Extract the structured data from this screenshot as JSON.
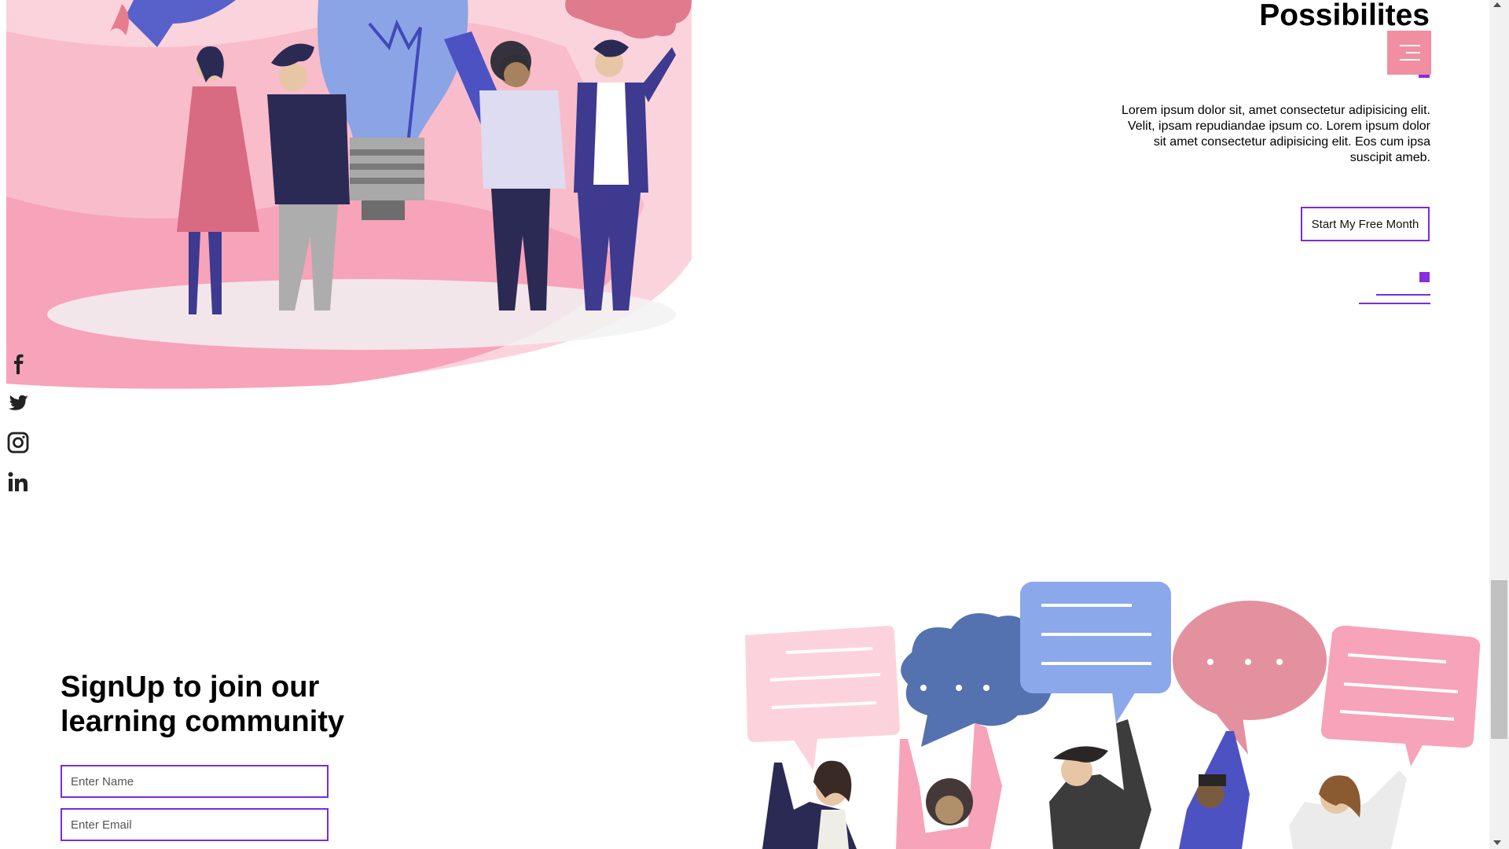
{
  "hero": {
    "title": "Possibilites",
    "paragraph": "Lorem ipsum dolor sit, amet consectetur adipisicing elit. Velit, ipsam repudiandae ipsum co. Lorem ipsum dolor sit amet consectetur adipisicing elit. Eos cum ipsa suscipit ameb.",
    "cta_label": "Start My Free Month",
    "menu_icon": "hamburger-menu-icon"
  },
  "social": {
    "items": [
      {
        "name": "facebook",
        "icon": "facebook-icon"
      },
      {
        "name": "twitter",
        "icon": "twitter-icon"
      },
      {
        "name": "instagram",
        "icon": "instagram-icon"
      },
      {
        "name": "linkedin",
        "icon": "linkedin-icon"
      }
    ]
  },
  "signup": {
    "title": "SignUp to join our learning community",
    "name_placeholder": "Enter Name",
    "email_placeholder": "Enter Email"
  },
  "colors": {
    "accent_purple": "#7a2be2",
    "menu_pink": "#f28ea2",
    "illustration_pink": "#f7a3b9",
    "illustration_blue": "#5b73b5",
    "illustration_navy": "#2b2a55"
  }
}
